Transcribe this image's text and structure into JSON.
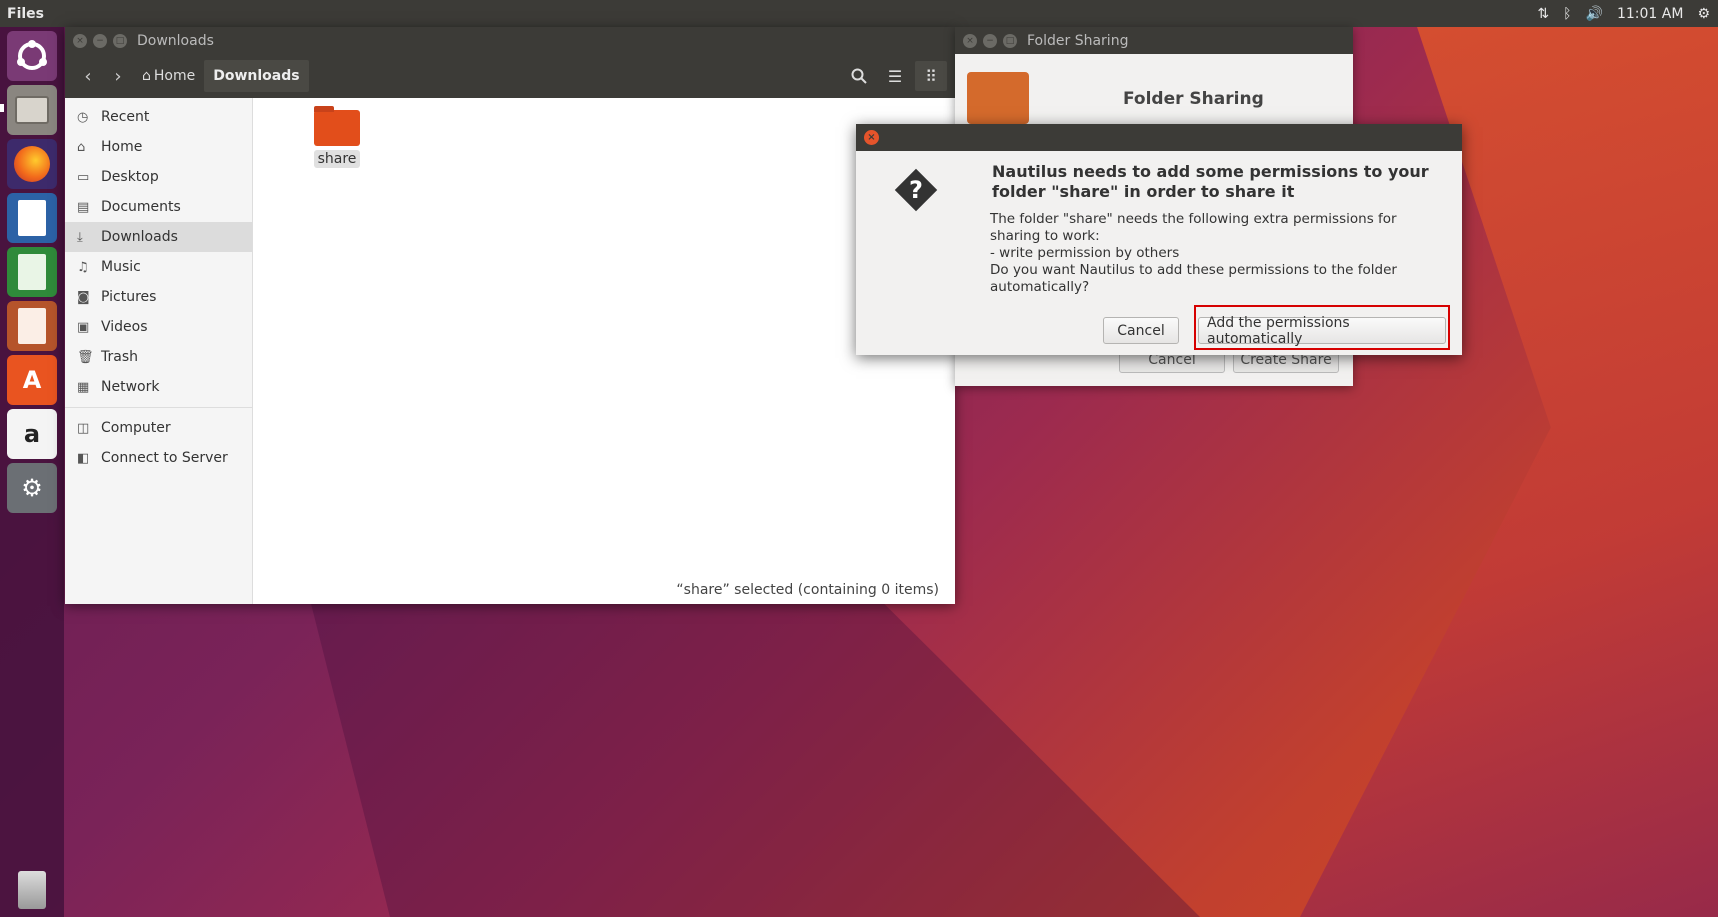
{
  "top_panel": {
    "app_title": "Files",
    "clock": "11:01 AM",
    "indicators": [
      "network-icon",
      "bluetooth-icon",
      "volume-icon",
      "settings-gear-icon"
    ]
  },
  "launcher": {
    "items": [
      "ubuntu-dash",
      "files",
      "firefox",
      "libreoffice-writer",
      "libreoffice-calc",
      "libreoffice-impress",
      "ubuntu-software",
      "amazon",
      "system-settings",
      "trash"
    ]
  },
  "files_window": {
    "title": "Downloads",
    "breadcrumbs": [
      "Home",
      "Downloads"
    ],
    "sidebar": [
      {
        "label": "Recent",
        "icon": "clock-icon"
      },
      {
        "label": "Home",
        "icon": "home-icon"
      },
      {
        "label": "Desktop",
        "icon": "desktop-icon"
      },
      {
        "label": "Documents",
        "icon": "documents-icon"
      },
      {
        "label": "Downloads",
        "icon": "download-icon",
        "selected": true
      },
      {
        "label": "Music",
        "icon": "music-icon"
      },
      {
        "label": "Pictures",
        "icon": "camera-icon"
      },
      {
        "label": "Videos",
        "icon": "video-icon"
      },
      {
        "label": "Trash",
        "icon": "trash-icon"
      },
      {
        "label": "Network",
        "icon": "network-icon"
      },
      {
        "label": "Computer",
        "icon": "computer-icon"
      },
      {
        "label": "Connect to Server",
        "icon": "server-icon"
      }
    ],
    "files": [
      {
        "name": "share"
      }
    ],
    "status": "“share” selected  (containing 0 items)"
  },
  "sharing_window": {
    "title": "Folder Sharing",
    "heading": "Folder Sharing",
    "cancel_label": "Cancel",
    "create_label": "Create Share"
  },
  "dialog": {
    "heading": "Nautilus needs to add some permissions to your folder \"share\" in order to share it",
    "body": "The folder \"share\" needs the following extra permissions for sharing to work:\n  - write permission by others\nDo you want Nautilus to add these permissions to the folder automatically?",
    "cancel_label": "Cancel",
    "confirm_label": "Add the permissions automatically"
  },
  "colors": {
    "accent": "#e95420",
    "panel": "#3c3b37",
    "highlight": "#d60000"
  }
}
